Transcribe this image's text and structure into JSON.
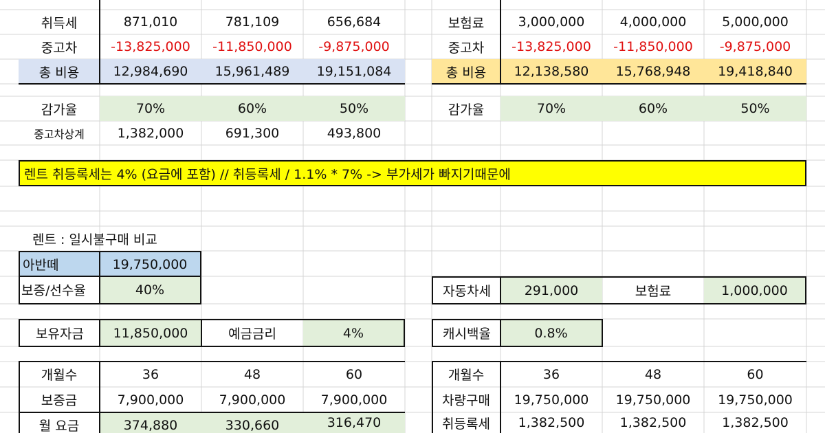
{
  "left_top": {
    "row_acq_tax": {
      "label": "취득세",
      "values": [
        "871,010",
        "781,109",
        "656,684"
      ]
    },
    "row_used": {
      "label": "중고차",
      "values": [
        "-13,825,000",
        "-11,850,000",
        "-9,875,000"
      ]
    },
    "row_total": {
      "label": "총 비용",
      "values": [
        "12,984,690",
        "15,961,489",
        "19,151,084"
      ]
    },
    "row_depr": {
      "label": "감가율",
      "values": [
        "70%",
        "60%",
        "50%"
      ]
    },
    "row_offset": {
      "label": "중고차상계",
      "values": [
        "1,382,000",
        "691,300",
        "493,800"
      ]
    }
  },
  "right_top": {
    "row_insurance": {
      "label": "보험료",
      "values": [
        "3,000,000",
        "4,000,000",
        "5,000,000"
      ]
    },
    "row_used": {
      "label": "중고차",
      "values": [
        "-13,825,000",
        "-11,850,000",
        "-9,875,000"
      ]
    },
    "row_total": {
      "label": "총 비용",
      "values": [
        "12,138,580",
        "15,768,948",
        "19,418,840"
      ]
    },
    "row_depr": {
      "label": "감가율",
      "values": [
        "70%",
        "60%",
        "50%"
      ]
    }
  },
  "banner": "렌트 취등록세는 4% (요금에 포함)    //  취등록세 / 1.1% * 7% -> 부가세가 빠지기때문에",
  "compare_title": "렌트 : 일시불구매 비교",
  "avante": {
    "label": "아반떼",
    "value": "19,750,000"
  },
  "deposit_rate": {
    "label": "보증/선수율",
    "value": "40%"
  },
  "car_tax": {
    "label": "자동차세",
    "value": "291,000",
    "ins_label": "보험료",
    "ins_value": "1,000,000"
  },
  "own_funds": {
    "label": "보유자금",
    "value": "11,850,000",
    "rate_label": "예금금리",
    "rate_value": "4%"
  },
  "cashback": {
    "label": "캐시백율",
    "value": "0.8%"
  },
  "left_bottom": {
    "months": {
      "label": "개월수",
      "values": [
        "36",
        "48",
        "60"
      ]
    },
    "deposit": {
      "label": "보증금",
      "values": [
        "7,900,000",
        "7,900,000",
        "7,900,000"
      ]
    },
    "monthly": {
      "label": "월 요금",
      "values": [
        "374,880",
        "330,660",
        "316,470"
      ]
    }
  },
  "right_bottom": {
    "months": {
      "label": "개월수",
      "values": [
        "36",
        "48",
        "60"
      ]
    },
    "purchase": {
      "label": "차량구매",
      "values": [
        "19,750,000",
        "19,750,000",
        "19,750,000"
      ]
    },
    "acq_reg": {
      "label": "취등록세",
      "values": [
        "1,382,500",
        "1,382,500",
        "1,382,500"
      ]
    }
  }
}
